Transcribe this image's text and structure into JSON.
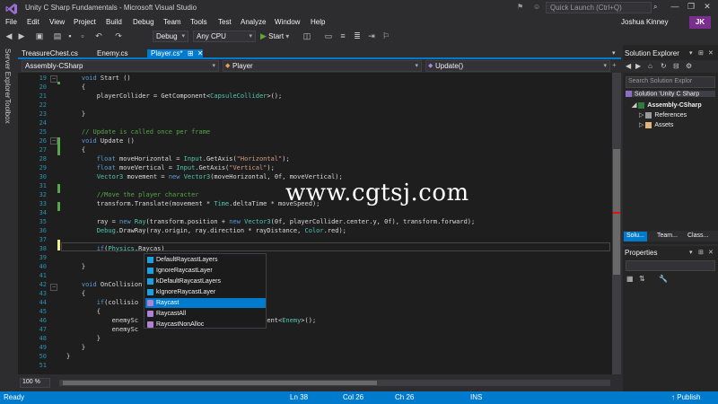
{
  "window": {
    "title": "Unity C Sharp Fundamentals - Microsoft Visual Studio",
    "quick_launch_placeholder": "Quick Launch (Ctrl+Q)",
    "user": "Joshua Kinney",
    "avatar_initials": "JK"
  },
  "menu": [
    "File",
    "Edit",
    "View",
    "Project",
    "Build",
    "Debug",
    "Team",
    "Tools",
    "Test",
    "Analyze",
    "Window",
    "Help"
  ],
  "toolbar": {
    "configuration": "Debug",
    "platform": "Any CPU",
    "start_label": "Start"
  },
  "side_tabs": [
    "Server Explorer",
    "Toolbox"
  ],
  "doc_tabs": [
    {
      "label": "TreasureChest.cs",
      "active": false
    },
    {
      "label": "Enemy.cs",
      "active": false
    },
    {
      "label": "Player.cs*",
      "active": true
    }
  ],
  "nav": {
    "project": "Assembly-CSharp",
    "type": "Player",
    "member": "Update()"
  },
  "code_lines": [
    {
      "n": "19",
      "text": "    void Start ()"
    },
    {
      "n": "20",
      "text": "    {"
    },
    {
      "n": "21",
      "text": "        playerCollider = GetComponent<CapsuleCollider>();"
    },
    {
      "n": "22",
      "text": ""
    },
    {
      "n": "23",
      "text": "    }"
    },
    {
      "n": "24",
      "text": ""
    },
    {
      "n": "25",
      "text": "    // Update is called once per frame"
    },
    {
      "n": "26",
      "text": "    void Update ()"
    },
    {
      "n": "27",
      "text": "    {"
    },
    {
      "n": "28",
      "text": "        float moveHorizontal = Input.GetAxis(\"Horizontal\");"
    },
    {
      "n": "29",
      "text": "        float moveVertical = Input.GetAxis(\"Vertical\");"
    },
    {
      "n": "30",
      "text": "        Vector3 movement = new Vector3(moveHorizontal, 0f, moveVertical);"
    },
    {
      "n": "31",
      "text": ""
    },
    {
      "n": "32",
      "text": "        //Move the player character"
    },
    {
      "n": "33",
      "text": "        transform.Translate(movement * Time.deltaTime * moveSpeed);"
    },
    {
      "n": "34",
      "text": ""
    },
    {
      "n": "35",
      "text": "        ray = new Ray(transform.position + new Vector3(0f, playerCollider.center.y, 0f), transform.forward);"
    },
    {
      "n": "36",
      "text": "        Debug.DrawRay(ray.origin, ray.direction * rayDistance, Color.red);"
    },
    {
      "n": "37",
      "text": ""
    },
    {
      "n": "38",
      "text": "        if(Physics.Raycas)"
    },
    {
      "n": "39",
      "text": ""
    },
    {
      "n": "40",
      "text": "    }"
    },
    {
      "n": "41",
      "text": ""
    },
    {
      "n": "42",
      "text": "    void OnCollision"
    },
    {
      "n": "43",
      "text": "    {"
    },
    {
      "n": "44",
      "text": "        if(collisio"
    },
    {
      "n": "45",
      "text": "        {"
    },
    {
      "n": "46",
      "text": "            enemySc                              mponent<Enemy>();"
    },
    {
      "n": "47",
      "text": "            enemySc"
    },
    {
      "n": "48",
      "text": "        }"
    },
    {
      "n": "49",
      "text": "    }"
    },
    {
      "n": "50",
      "text": "}"
    },
    {
      "n": "51",
      "text": ""
    }
  ],
  "completion": [
    {
      "label": "DefaultRaycastLayers",
      "kind": "field"
    },
    {
      "label": "IgnoreRaycastLayer",
      "kind": "field"
    },
    {
      "label": "kDefaultRaycastLayers",
      "kind": "field"
    },
    {
      "label": "kIgnoreRaycastLayer",
      "kind": "field"
    },
    {
      "label": "Raycast",
      "kind": "method",
      "selected": true
    },
    {
      "label": "RaycastAll",
      "kind": "method"
    },
    {
      "label": "RaycastNonAlloc",
      "kind": "method"
    }
  ],
  "watermark": "www.cgtsj.com",
  "zoom": "100 %",
  "solution_explorer": {
    "title": "Solution Explorer",
    "search_placeholder": "Search Solution Explor",
    "tree": [
      {
        "label": "Solution 'Unity C Sharp",
        "level": 0
      },
      {
        "label": "Assembly-CSharp",
        "level": 1,
        "bold": true
      },
      {
        "label": "References",
        "level": 2
      },
      {
        "label": "Assets",
        "level": 2
      }
    ],
    "tabs": [
      "Solu...",
      "Team...",
      "Class..."
    ]
  },
  "properties": {
    "title": "Properties"
  },
  "status": {
    "ready": "Ready",
    "line": "Ln 38",
    "col": "Col 26",
    "ch": "Ch 26",
    "mode": "INS",
    "publish": "Publish"
  },
  "colors": {
    "accent": "#007acc",
    "keyword": "#569cd6",
    "type": "#4ec9b0",
    "string": "#d69d85",
    "comment": "#57a64a",
    "line_number": "#2b91af"
  }
}
